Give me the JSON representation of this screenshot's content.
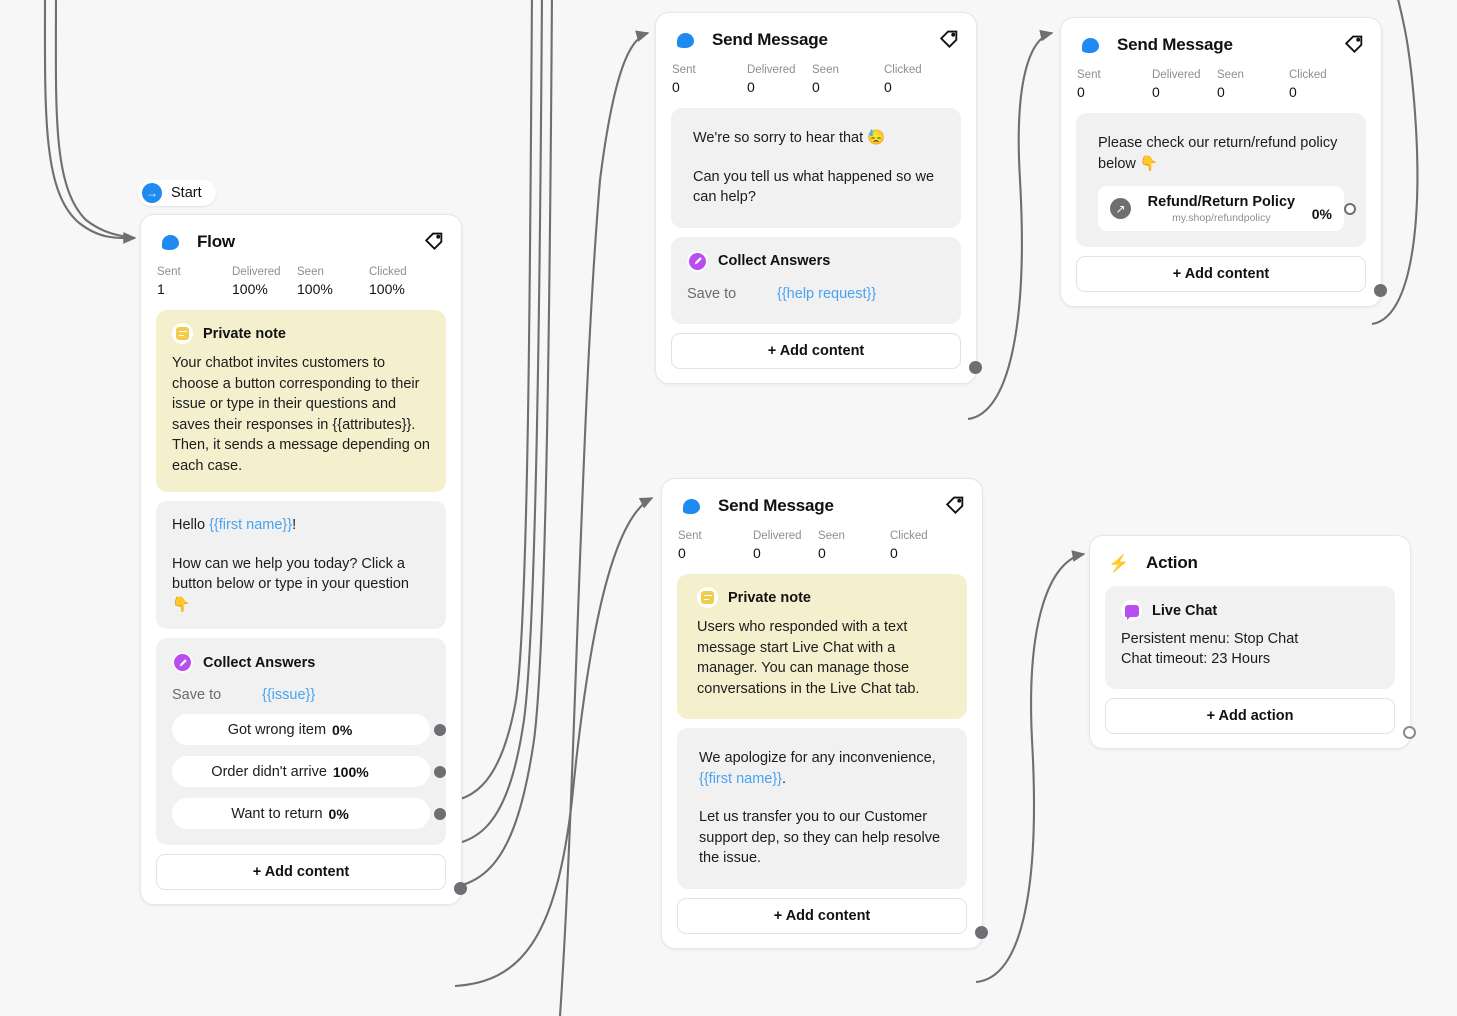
{
  "canvas": {
    "background": "#f7f7f7",
    "edge_color": "#6e6e73"
  },
  "start": {
    "label": "Start",
    "icon": "arrow-right-icon"
  },
  "stat_labels": {
    "sent": "Sent",
    "delivered": "Delivered",
    "seen": "Seen",
    "clicked": "Clicked"
  },
  "common": {
    "add_content": "+ Add content",
    "add_action": "+ Add action",
    "save_to": "Save to",
    "collect_answers": "Collect Answers",
    "private_note": "Private note",
    "tag_icon": "tag-icon",
    "message_icon": "chat-bubble-icon",
    "action_icon": "lightning-bolt-icon"
  },
  "nodes": [
    {
      "id": "flow",
      "title": "Flow",
      "stats": {
        "sent": "1",
        "delivered": "100%",
        "seen": "100%",
        "clicked": "100%"
      },
      "note": {
        "title": "Private note",
        "text": "Your chatbot invites customers to choose a button corresponding to their issue or type in their questions and saves their responses in {{attributes}}. Then, it sends a message depending on each case."
      },
      "message": {
        "line1_plain": "Hello ",
        "line1_var": "{{first name}}",
        "line1_end": "!",
        "line2": "How can we help you today? Click a button below or type in your question 👇"
      },
      "collect": {
        "title": "Collect Answers",
        "save_label": "Save to",
        "save_value": "{{issue}}",
        "replies": [
          {
            "label": "Got wrong item",
            "pct": "0%"
          },
          {
            "label": "Order didn't arrive",
            "pct": "100%"
          },
          {
            "label": "Want to return",
            "pct": "0%"
          }
        ]
      },
      "add_label": "+ Add content"
    },
    {
      "id": "send-message-top",
      "title": "Send Message",
      "stats": {
        "sent": "0",
        "delivered": "0",
        "seen": "0",
        "clicked": "0"
      },
      "message": {
        "line1": "We're so sorry to hear that 😓",
        "line2": "Can you tell us what happened so we can help?"
      },
      "collect": {
        "title": "Collect Answers",
        "save_label": "Save to",
        "save_value": "{{help request}}"
      },
      "add_label": "+ Add content"
    },
    {
      "id": "send-message-refund",
      "title": "Send Message",
      "stats": {
        "sent": "0",
        "delivered": "0",
        "seen": "0",
        "clicked": "0"
      },
      "message": {
        "line1": "Please check our return/refund policy below 👇"
      },
      "link": {
        "title": "Refund/Return Policy",
        "url": "my.shop/refundpolicy",
        "pct": "0%",
        "icon": "external-link-icon"
      },
      "add_label": "+ Add content"
    },
    {
      "id": "send-message-livechat",
      "title": "Send Message",
      "stats": {
        "sent": "0",
        "delivered": "0",
        "seen": "0",
        "clicked": "0"
      },
      "note": {
        "title": "Private note",
        "text": "Users who responded with a text message start Live Chat with a manager. You can manage those conversations in the Live Chat tab."
      },
      "message": {
        "line1_plain": "We apologize for any inconvenience, ",
        "line1_var": "{{first name}}",
        "line1_end": ".",
        "line2": "Let us transfer you to our Customer support dep, so they can help resolve the issue."
      },
      "add_label": "+ Add content"
    },
    {
      "id": "action",
      "title": "Action",
      "item": {
        "title": "Live Chat",
        "line1": "Persistent menu: Stop Chat",
        "line2": "Chat timeout: 23 Hours",
        "icon": "live-chat-icon"
      },
      "add_label": "+ Add action"
    }
  ]
}
